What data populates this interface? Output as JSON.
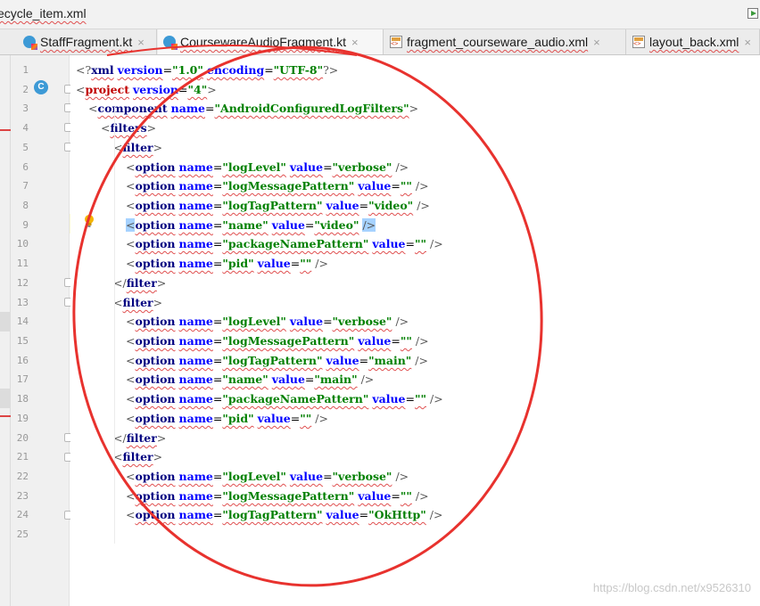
{
  "window": {
    "file_title": "ecycle_item.xml"
  },
  "tabs": [
    {
      "label": "StaffFragment.kt",
      "kind": "kotlin",
      "close": "×"
    },
    {
      "label": "CoursewareAudioFragment.kt",
      "kind": "kotlin",
      "close": "×"
    },
    {
      "label": "fragment_courseware_audio.xml",
      "kind": "xml",
      "close": "×"
    },
    {
      "label": "layout_back.xml",
      "kind": "xml",
      "close": "×"
    }
  ],
  "gutter": {
    "line_numbers": [
      "1",
      "2",
      "3",
      "4",
      "5",
      "6",
      "7",
      "8",
      "9",
      "10",
      "11",
      "12",
      "13",
      "14",
      "15",
      "16",
      "17",
      "18",
      "19",
      "20",
      "21",
      "22",
      "23",
      "24",
      "25"
    ],
    "class_icon": "C"
  },
  "code": {
    "l1": {
      "open": "<?",
      "name": "xml",
      "a1": "version",
      "v1": "\"1.0\"",
      "a2": "encoding",
      "v2": "\"UTF-8\"",
      "close": "?>"
    },
    "l2": {
      "open": "<",
      "name": "project",
      "a1": "version",
      "v1": "\"4\"",
      "close": ">"
    },
    "l3": {
      "open": "<",
      "name": "component",
      "a1": "name",
      "v1": "\"AndroidConfiguredLogFilters\"",
      "close": ">"
    },
    "l4": {
      "open": "<",
      "name": "filters",
      "close": ">"
    },
    "l5": {
      "open": "<",
      "name": "filter",
      "close": ">"
    },
    "l6": {
      "open": "<",
      "name": "option",
      "a1": "name",
      "v1": "\"logLevel\"",
      "a2": "value",
      "v2": "\"verbose\"",
      "close": "/>"
    },
    "l7": {
      "open": "<",
      "name": "option",
      "a1": "name",
      "v1": "\"logMessagePattern\"",
      "a2": "value",
      "v2": "\"\"",
      "close": "/>"
    },
    "l8": {
      "open": "<",
      "name": "option",
      "a1": "name",
      "v1": "\"logTagPattern\"",
      "a2": "value",
      "v2": "\"video\"",
      "close": "/>"
    },
    "l9": {
      "open": "<",
      "name": "option",
      "a1": "name",
      "v1": "\"name\"",
      "a2": "value",
      "v2": "\"video\"",
      "close": "/>"
    },
    "l10": {
      "open": "<",
      "name": "option",
      "a1": "name",
      "v1": "\"packageNamePattern\"",
      "a2": "value",
      "v2": "\"\"",
      "close": "/>"
    },
    "l11": {
      "open": "<",
      "name": "option",
      "a1": "name",
      "v1": "\"pid\"",
      "a2": "value",
      "v2": "\"\"",
      "close": "/>"
    },
    "l12": {
      "open": "</",
      "name": "filter",
      "close": ">"
    },
    "l13": {
      "open": "<",
      "name": "filter",
      "close": ">"
    },
    "l14": {
      "open": "<",
      "name": "option",
      "a1": "name",
      "v1": "\"logLevel\"",
      "a2": "value",
      "v2": "\"verbose\"",
      "close": "/>"
    },
    "l15": {
      "open": "<",
      "name": "option",
      "a1": "name",
      "v1": "\"logMessagePattern\"",
      "a2": "value",
      "v2": "\"\"",
      "close": "/>"
    },
    "l16": {
      "open": "<",
      "name": "option",
      "a1": "name",
      "v1": "\"logTagPattern\"",
      "a2": "value",
      "v2": "\"main\"",
      "close": "/>"
    },
    "l17": {
      "open": "<",
      "name": "option",
      "a1": "name",
      "v1": "\"name\"",
      "a2": "value",
      "v2": "\"main\"",
      "close": "/>"
    },
    "l18": {
      "open": "<",
      "name": "option",
      "a1": "name",
      "v1": "\"packageNamePattern\"",
      "a2": "value",
      "v2": "\"\"",
      "close": "/>"
    },
    "l19": {
      "open": "<",
      "name": "option",
      "a1": "name",
      "v1": "\"pid\"",
      "a2": "value",
      "v2": "\"\"",
      "close": "/>"
    },
    "l20": {
      "open": "</",
      "name": "filter",
      "close": ">"
    },
    "l21": {
      "open": "<",
      "name": "filter",
      "close": ">"
    },
    "l22": {
      "open": "<",
      "name": "option",
      "a1": "name",
      "v1": "\"logLevel\"",
      "a2": "value",
      "v2": "\"verbose\"",
      "close": "/>"
    },
    "l23": {
      "open": "<",
      "name": "option",
      "a1": "name",
      "v1": "\"logMessagePattern\"",
      "a2": "value",
      "v2": "\"\"",
      "close": "/>"
    },
    "l24": {
      "open": "<",
      "name": "option",
      "a1": "name",
      "v1": "\"logTagPattern\"",
      "a2": "value",
      "v2": "\"OkHttp\"",
      "close": "/>"
    }
  },
  "icons": {
    "kotlin_tab": "kotlin-file-icon",
    "xml_tab": "xml-file-icon",
    "class_gutter": "class-icon",
    "bulb": "intention-bulb-icon",
    "run": "run-icon"
  },
  "colors": {
    "tag": "#000080",
    "attr": "#0000ff",
    "value": "#008000",
    "root_tag": "#c00000",
    "caret_row": "#fcfad8",
    "annotation": "#e8322e"
  },
  "watermark": "https://blog.csdn.net/x9526310"
}
